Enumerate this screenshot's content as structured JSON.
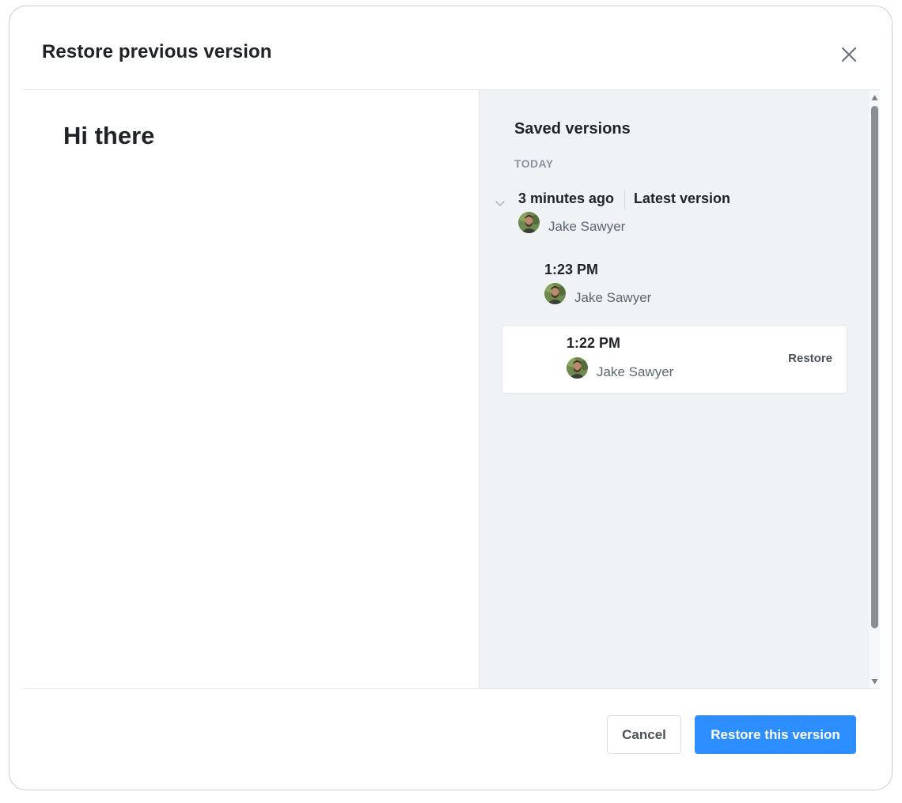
{
  "modal": {
    "title": "Restore previous version",
    "close_icon": "close-icon"
  },
  "preview": {
    "heading": "Hi there"
  },
  "versions": {
    "title": "Saved versions",
    "group_label": "TODAY",
    "items": [
      {
        "time": "3 minutes ago",
        "badge": "Latest version",
        "author": "Jake Sawyer",
        "expand_icon": "chevron-down-icon"
      },
      {
        "time": "1:23 PM",
        "author": "Jake Sawyer"
      },
      {
        "time": "1:22 PM",
        "author": "Jake Sawyer",
        "action": "Restore"
      }
    ]
  },
  "footer": {
    "cancel_label": "Cancel",
    "primary_label": "Restore this version"
  },
  "colors": {
    "primary": "#2d8fff",
    "panel_bg": "#f0f3f6",
    "muted_text": "#8b939c"
  }
}
